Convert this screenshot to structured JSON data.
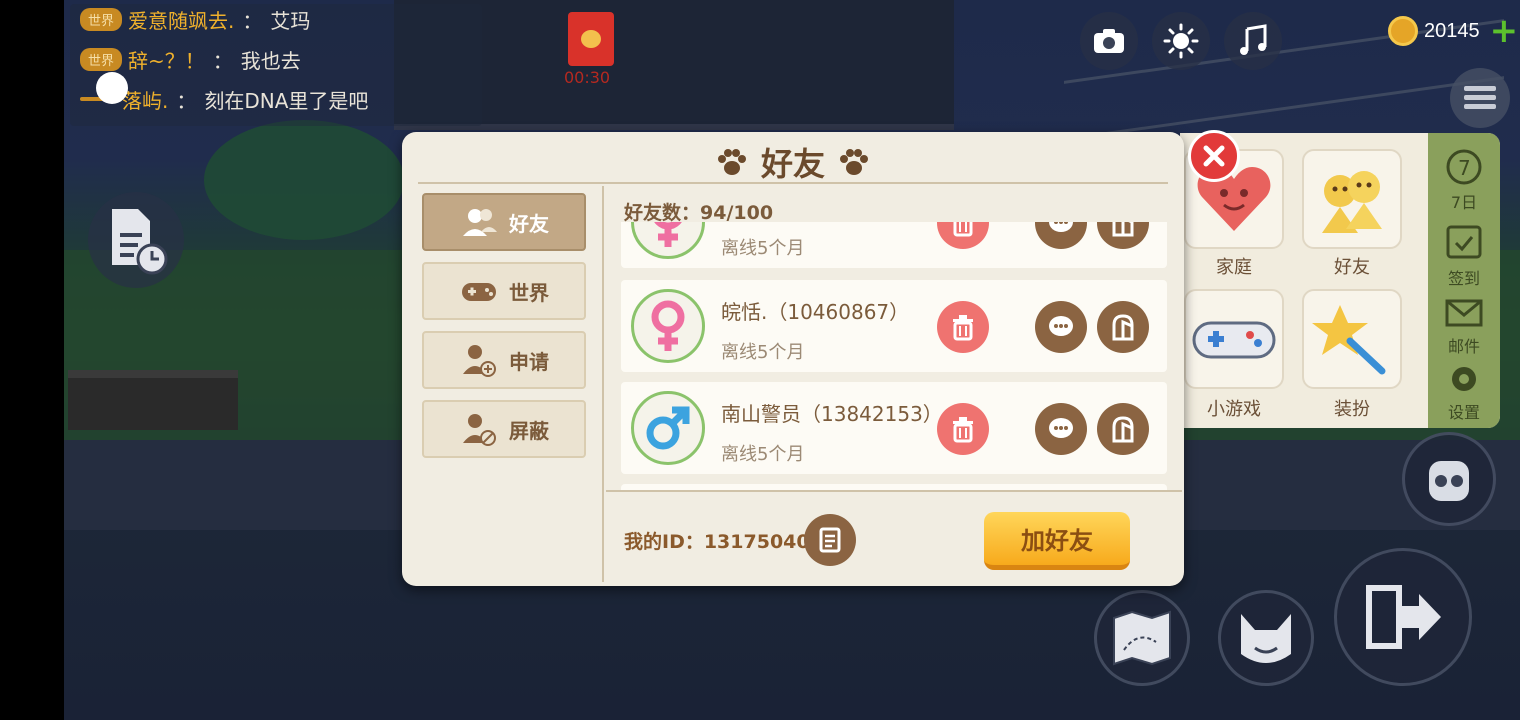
{
  "chat": {
    "lines": [
      {
        "tag": "世界",
        "name": "爱意随飒去.",
        "sep": "：",
        "text": "艾玛"
      },
      {
        "tag": "世界",
        "name": "辞~？！",
        "sep": "：",
        "text": "我也去"
      },
      {
        "tag": "",
        "name": "落屿.",
        "sep": "：",
        "text": "刻在DNA里了是吧"
      }
    ]
  },
  "redpack": {
    "timer": "00:30"
  },
  "hud": {
    "coins": "20145",
    "icons": [
      "camera-icon",
      "brightness-icon",
      "music-icon",
      "menu-icon",
      "plus-icon"
    ]
  },
  "side_panel": {
    "tiles": [
      {
        "label": "家庭",
        "icon": "heart-icon"
      },
      {
        "label": "好友",
        "icon": "friends-icon"
      },
      {
        "label": "小游戏",
        "icon": "gamepad-icon"
      },
      {
        "label": "装扮",
        "icon": "magic-wand-icon"
      }
    ],
    "strip": [
      {
        "label": "7日",
        "icon": "seven-day-icon"
      },
      {
        "label": "签到",
        "icon": "checkin-icon"
      },
      {
        "label": "邮件",
        "icon": "mail-icon"
      },
      {
        "label": "设置",
        "icon": "settings-icon"
      }
    ]
  },
  "modal": {
    "title": "好友",
    "tabs": [
      {
        "label": "好友",
        "icon": "friends-icon",
        "active": true
      },
      {
        "label": "世界",
        "icon": "gamepad-icon",
        "active": false
      },
      {
        "label": "申请",
        "icon": "add-user-icon",
        "active": false
      },
      {
        "label": "屏蔽",
        "icon": "block-user-icon",
        "active": false
      }
    ],
    "count_label": "好友数：94/100",
    "friends": [
      {
        "name": "",
        "status": "离线5个月",
        "gender": "female"
      },
      {
        "name": "皖恬.（10460867）",
        "status": "离线5个月",
        "gender": "female"
      },
      {
        "name": "南山警员（13842153）",
        "status": "离线5个月",
        "gender": "male"
      }
    ],
    "my_id": "我的ID：13175040",
    "add_button": "加好友"
  },
  "colors": {
    "accent": "#8b6442",
    "delete": "#ef7370",
    "female": "#ef6fa1",
    "male": "#3ca3df",
    "add_button": "#f7aa1c"
  }
}
